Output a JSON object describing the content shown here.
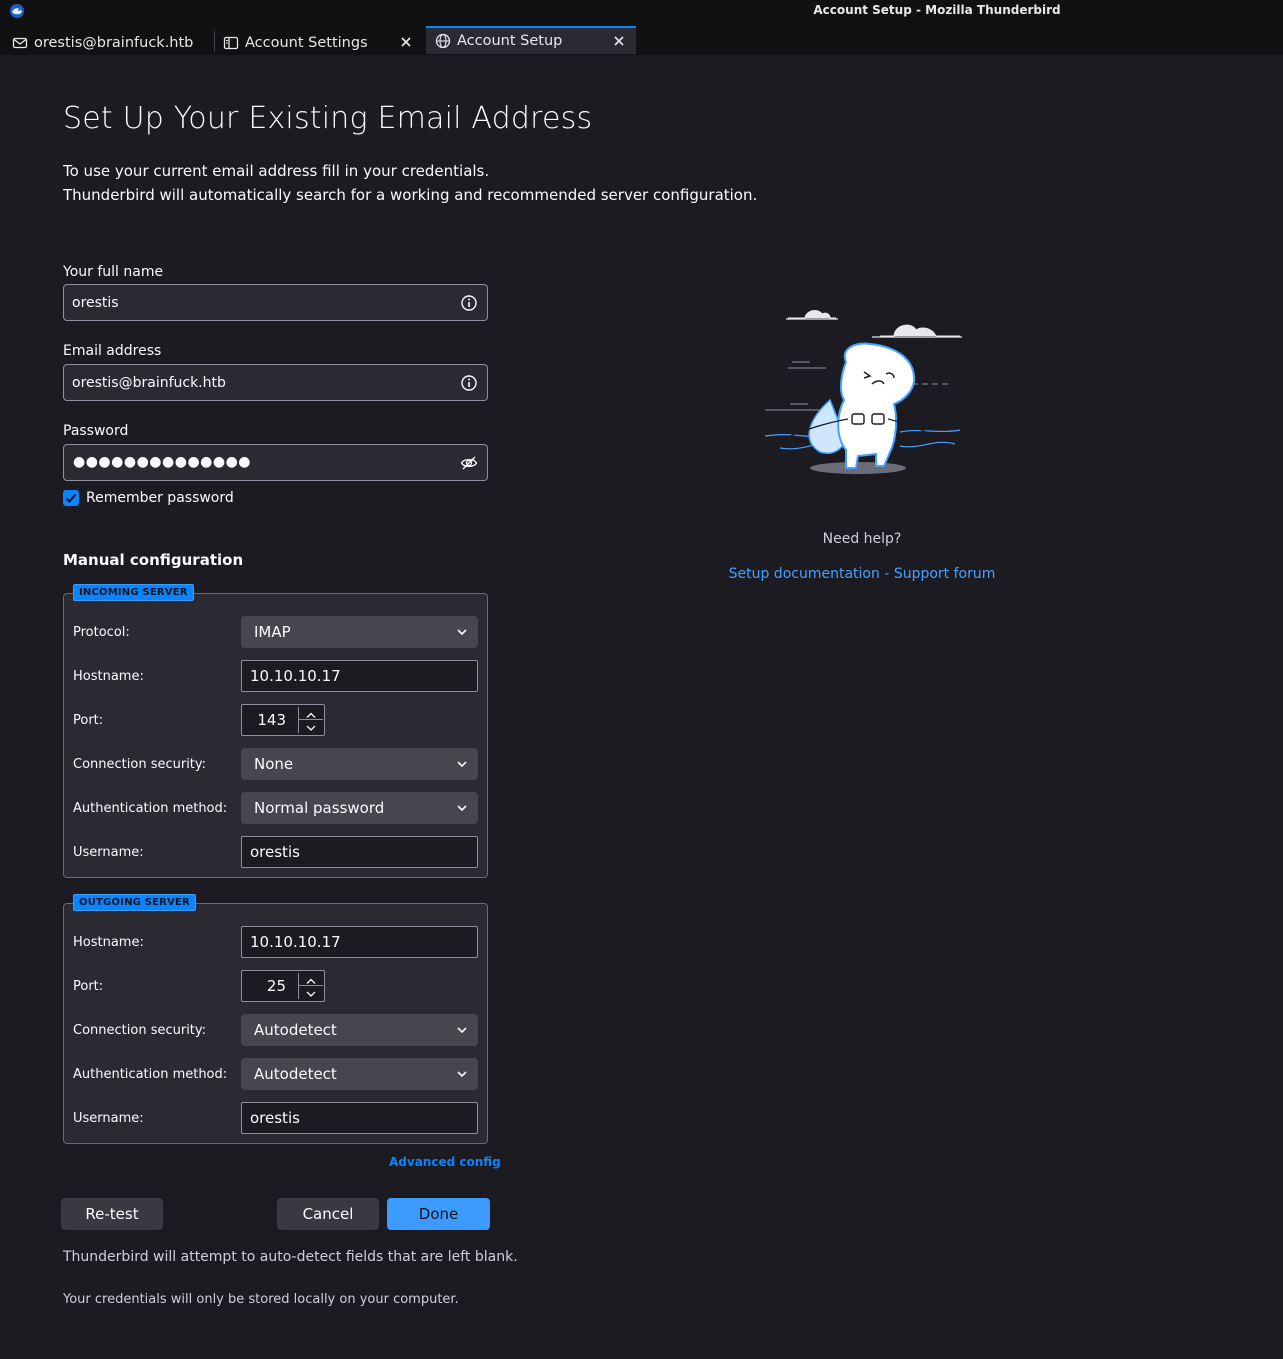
{
  "window": {
    "title": "Account Setup - Mozilla Thunderbird"
  },
  "tabs": [
    {
      "label": "orestis@brainfuck.htb"
    },
    {
      "label": "Account Settings"
    },
    {
      "label": "Account Setup"
    }
  ],
  "page": {
    "heading": "Set Up Your Existing Email Address",
    "intro_line1": "To use your current email address fill in your credentials.",
    "intro_line2": "Thunderbird will automatically search for a working and recommended server configuration."
  },
  "form": {
    "name_label": "Your full name",
    "name_value": "orestis",
    "email_label": "Email address",
    "email_value": "orestis@brainfuck.htb",
    "password_label": "Password",
    "password_mask": "●●●●●●●●●●●●●●",
    "remember_label": "Remember password",
    "remember_checked": true
  },
  "manual": {
    "title": "Manual configuration",
    "incoming": {
      "badge": "INCOMING SERVER",
      "protocol_label": "Protocol:",
      "protocol_value": "IMAP",
      "hostname_label": "Hostname:",
      "hostname_value": "10.10.10.17",
      "port_label": "Port:",
      "port_value": "143",
      "security_label": "Connection security:",
      "security_value": "None",
      "auth_label": "Authentication method:",
      "auth_value": "Normal password",
      "username_label": "Username:",
      "username_value": "orestis"
    },
    "outgoing": {
      "badge": "OUTGOING SERVER",
      "hostname_label": "Hostname:",
      "hostname_value": "10.10.10.17",
      "port_label": "Port:",
      "port_value": "25",
      "security_label": "Connection security:",
      "security_value": "Autodetect",
      "auth_label": "Authentication method:",
      "auth_value": "Autodetect",
      "username_label": "Username:",
      "username_value": "orestis"
    },
    "advanced_label": "Advanced config"
  },
  "buttons": {
    "retest": "Re-test",
    "cancel": "Cancel",
    "done": "Done"
  },
  "notes": {
    "autodetect": "Thunderbird will attempt to auto-detect fields that are left blank.",
    "credentials": "Your credentials will only be stored locally on your computer."
  },
  "help": {
    "need_help": "Need help?",
    "doc_link": "Setup documentation",
    "separator": "-",
    "forum_link": "Support forum"
  },
  "colors": {
    "accent": "#0a84ff",
    "background": "#1c1b22",
    "link": "#45a1ff"
  }
}
